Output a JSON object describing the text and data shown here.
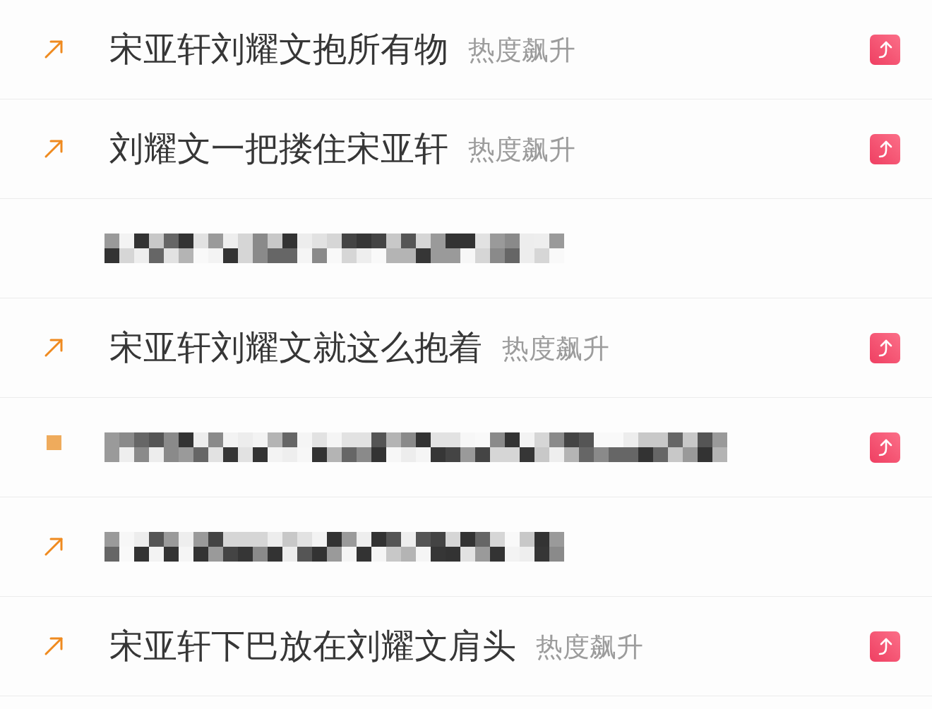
{
  "trending_list": {
    "items": [
      {
        "kind": "topic",
        "marker": {
          "kind": "arrow"
        },
        "title": "宋亚轩刘耀文抱所有物",
        "tag": "热度飙升",
        "share": true
      },
      {
        "kind": "topic",
        "marker": {
          "kind": "arrow"
        },
        "title": "刘耀文一把搂住宋亚轩",
        "tag": "热度飙升",
        "share": true
      },
      {
        "kind": "pixelated",
        "share": false
      },
      {
        "kind": "topic",
        "marker": {
          "kind": "arrow"
        },
        "title": "宋亚轩刘耀文就这么抱着",
        "tag": "热度飙升",
        "share": true
      },
      {
        "kind": "pixelated",
        "marker": {
          "kind": "square"
        },
        "share": true
      },
      {
        "kind": "pixelated",
        "marker": {
          "kind": "arrow"
        },
        "share": false
      },
      {
        "kind": "topic",
        "marker": {
          "kind": "arrow"
        },
        "title": "宋亚轩下巴放在刘耀文肩头",
        "tag": "热度飙升",
        "share": true
      }
    ]
  }
}
